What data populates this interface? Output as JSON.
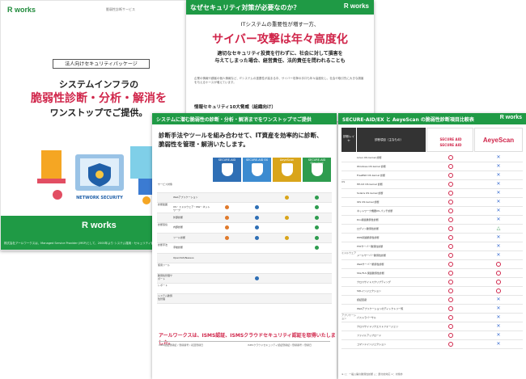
{
  "page1": {
    "logo": "R works",
    "tag_small": "脆弱性診断サービス",
    "package_label": "法人向けセキュリティパッケージ",
    "headline_line1": "システムインフラの",
    "headline_line2": "脆弱性診断・分析・解消を",
    "headline_line3": "ワンストップでご提供。",
    "illustration_label": "NETWORK SECURITY",
    "footer_logo": "R works",
    "footer_text": "株式会社アールワークスは、Managed Service Provider (MSP)として、2000年より システム運用・セキュリティ管理サービス"
  },
  "page2": {
    "title": "なぜセキュリティ対策が必要なのか？",
    "logo": "R works",
    "subtitle": "ITシステムの重要性が増す一方、",
    "big_heading": "サイバー攻撃は年々高度化",
    "body_line1": "適切なセキュリティ投資を行わずに、社会に対して損害を",
    "body_line2": "与えてしまった場合、経営責任、法的責任を問われることも",
    "note": "企業の情報や顧客の個人情報など、ITシステムの重要性が高まる中、サイバー攻撃の手口も年々高度化し、社会や取引先に大きな損害を与えるケースが増えています。",
    "comparison_title": "情報セキュリティ10大脅威（組織向け）"
  },
  "page3": {
    "title": "システムに潜む脆弱性の診断・分析・解消までをワンストップでご提供",
    "intro_line1": "診断手法やツールを組み合わせて、IT資産を効率的に診断、",
    "intro_line2": "脆弱性を管理・解消いたします。",
    "columns": [
      {
        "name": "SECURE-AID",
        "color": "#2f6fb5"
      },
      {
        "name": "SECURE-AID EX",
        "color": "#3c8bd0"
      },
      {
        "name": "AeyeScan",
        "color": "#d9a51b"
      },
      {
        "name": "SECURE-AID Standard",
        "color": "#2e9c4f"
      }
    ],
    "rows": [
      {
        "category": "サービス対象",
        "item": "",
        "marks": [
          "",
          "",
          "",
          ""
        ]
      },
      {
        "category": "",
        "item": "Webアプリケーション",
        "marks": [
          "",
          "",
          "#d9a51b",
          "#2e9c4f"
        ]
      },
      {
        "category": "診断範囲",
        "item": "OS・ミドルウェア・NW・ネットワーク",
        "marks": [
          "#e07a2c",
          "#2f6fb5",
          "",
          "#2e9c4f"
        ]
      },
      {
        "category": "",
        "item": "外部診断",
        "marks": [
          "#e07a2c",
          "#2f6fb5",
          "#d9a51b",
          "#2e9c4f"
        ]
      },
      {
        "category": "診断環境",
        "item": "内部診断",
        "marks": [
          "#e07a2c",
          "#2f6fb5",
          "",
          "#2e9c4f"
        ]
      },
      {
        "category": "",
        "item": "ツール診断",
        "marks": [
          "#e07a2c",
          "#2f6fb5",
          "#d9a51b",
          "#2e9c4f"
        ]
      },
      {
        "category": "診断手法",
        "item": "手動診断",
        "marks": [
          "",
          "",
          "",
          "#2e9c4f"
        ]
      },
      {
        "category": "",
        "item": "OpenVAS/Nessus",
        "marks": [
          "",
          "",
          "",
          ""
        ]
      },
      {
        "category": "使用ツール",
        "item": "",
        "marks": [
          "",
          "",
          "",
          ""
        ]
      },
      {
        "category": "脆弱性管理サポート",
        "item": "",
        "marks": [
          "",
          "#2f6fb5",
          "",
          ""
        ]
      },
      {
        "category": "レポート",
        "item": "",
        "marks": [
          "",
          "",
          "",
          ""
        ]
      },
      {
        "category": "システム脆弱性管理",
        "item": "",
        "marks": [
          "",
          "",
          "",
          ""
        ]
      }
    ],
    "isms_text": "アールワークスは、ISMS認証、ISMSクラウドセキュリティ認証を取得いたしました。",
    "cert_left": "ISMS認証登録証 / 登録番号 / 初回登録日",
    "cert_right": "ISMSクラウドセキュリティ認証登録証 / 登録番号 / 登録日"
  },
  "page4": {
    "title": "SECURE-AID/EX と AeyeScan の脆弱性診断項目比較表",
    "logo": "R works",
    "header_layer": "診断レイヤ",
    "header_item": "診断項目（主なもの）",
    "brand_a1": "SECURE AID",
    "brand_a2": "SECURE AID",
    "brand_b": "AeyeScan",
    "rows": [
      {
        "layer": "",
        "item": "Linux OS kernel 診断",
        "a": "o",
        "b": "x"
      },
      {
        "layer": "",
        "item": "Windows OS kernel 診断",
        "a": "o",
        "b": "x"
      },
      {
        "layer": "",
        "item": "FreeBSD OS kernel 診断",
        "a": "o",
        "b": "x"
      },
      {
        "layer": "OS",
        "item": "HP-UX OS kernel 診断",
        "a": "o",
        "b": "x"
      },
      {
        "layer": "",
        "item": "Solaris OS kernel 診断",
        "a": "o",
        "b": "x"
      },
      {
        "layer": "",
        "item": "IOS OS kernel 診断",
        "a": "o",
        "b": "x"
      },
      {
        "layer": "",
        "item": "ネットワーク機器OS パッチ診断",
        "a": "o",
        "b": "x"
      },
      {
        "layer": "",
        "item": "Dns関連脆弱性診断",
        "a": "o",
        "b": "x"
      },
      {
        "layer": "",
        "item": "ログイン脆弱性診断",
        "a": "o",
        "b": "t"
      },
      {
        "layer": "",
        "item": "DNS関連脆弱性診断",
        "a": "o",
        "b": "x"
      },
      {
        "layer": "",
        "item": "FTPサーバー脆弱性診断",
        "a": "o",
        "b": "x"
      },
      {
        "layer": "ミドルウェア",
        "item": "メールサーバー脆弱性診断",
        "a": "o",
        "b": "x"
      },
      {
        "layer": "",
        "item": "Webサーバー脆弱性診断",
        "a": "o",
        "b": "o"
      },
      {
        "layer": "",
        "item": "SSL/TLS 関連脆弱性診断",
        "a": "o",
        "b": "o"
      },
      {
        "layer": "",
        "item": "クロスサイトスクリプティング",
        "a": "o",
        "b": "o"
      },
      {
        "layer": "",
        "item": "SQLインジェクション",
        "a": "o",
        "b": "o"
      },
      {
        "layer": "",
        "item": "認証回避",
        "a": "o",
        "b": "x"
      },
      {
        "layer": "",
        "item": "Webアプリケーションのディレクトリ一覧",
        "a": "o",
        "b": "x"
      },
      {
        "layer": "アプリケーション",
        "item": "パストラバーサル",
        "a": "o",
        "b": "x"
      },
      {
        "layer": "",
        "item": "クロスサイトリクエストフォージェリ",
        "a": "o",
        "b": "x"
      },
      {
        "layer": "",
        "item": "ファイルアップロード",
        "a": "o",
        "b": "x"
      },
      {
        "layer": "",
        "item": "コマンドインジェクション",
        "a": "o",
        "b": "x"
      }
    ],
    "footnote": "※ ○：一般公開の脆弱性診断 △：部分的対応 ×：対象外"
  },
  "colors": {
    "brand_green": "#1f9a45",
    "accent_red": "#d0254a"
  }
}
